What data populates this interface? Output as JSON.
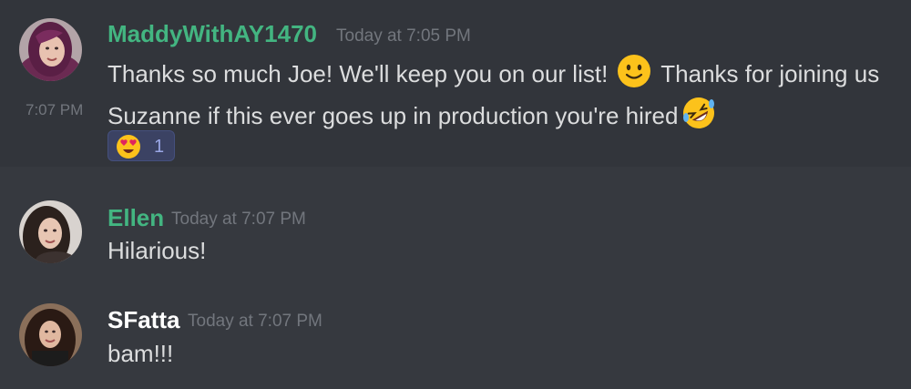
{
  "colors": {
    "background": "#36393f",
    "hover_band": "#32353b",
    "text": "#dcddde",
    "timestamp": "#72767d",
    "username_green": "#43b581",
    "username_white": "#ffffff",
    "reaction_bg": "#3b4263",
    "reaction_count": "#9aa7e6"
  },
  "messages": [
    {
      "author": "MaddyWithAY1470",
      "timestamp": "Today at 7:05 PM",
      "avatar_icon": "user-avatar-maddy",
      "lines": [
        {
          "text": "Thanks so much Joe! We'll keep you on our list! ",
          "emoji": "slightly-smiling-face-icon",
          "text_after": " Thanks for joining us"
        },
        {
          "side_time": "7:07 PM",
          "text": "Suzanne  if this ever goes up in production you're hired",
          "emoji": "rolling-on-floor-laughing-icon"
        }
      ],
      "reaction": {
        "emoji": "heart-eyes-icon",
        "count": "1"
      }
    },
    {
      "author": "Ellen",
      "timestamp": "Today at 7:07 PM",
      "avatar_icon": "user-avatar-ellen",
      "lines": [
        {
          "text": "Hilarious!"
        }
      ]
    },
    {
      "author": "SFatta",
      "timestamp": "Today at 7:07 PM",
      "avatar_icon": "user-avatar-sfatta",
      "lines": [
        {
          "text": "bam!!!"
        }
      ]
    }
  ]
}
